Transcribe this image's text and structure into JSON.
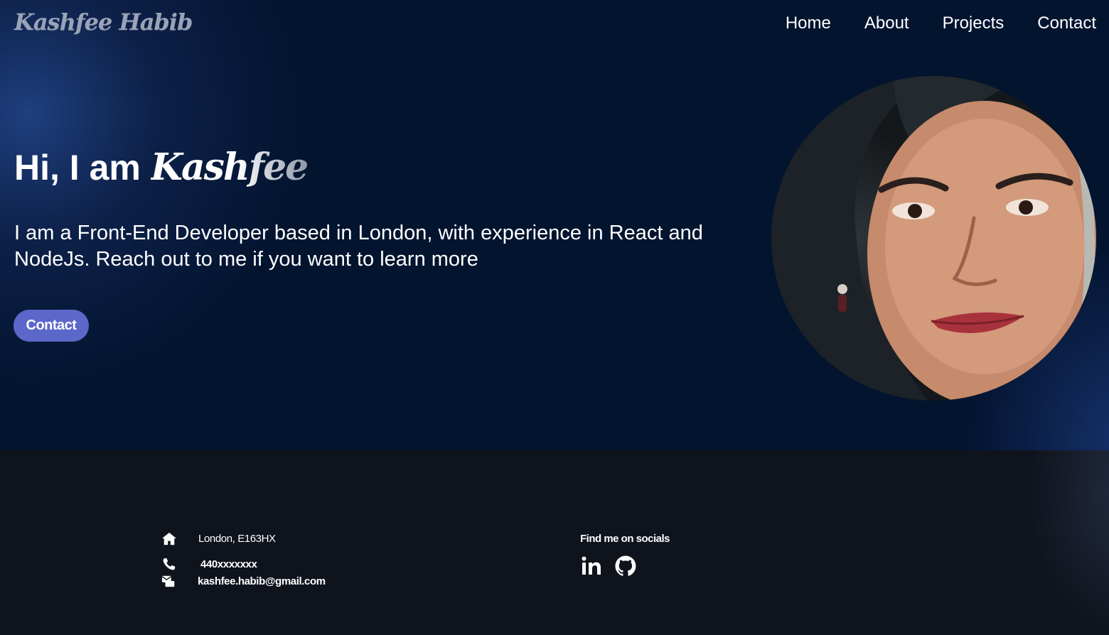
{
  "nav": {
    "logo": "Kashfee Habib",
    "links": [
      "Home",
      "About",
      "Projects",
      "Contact"
    ]
  },
  "hero": {
    "greeting": "Hi, I am",
    "name": "Kashfee",
    "intro": "I am a Front-End Developer based in London, with experience in React and NodeJs. Reach out to me if you want to learn more",
    "button_label": "Contact",
    "portrait_alt": "Portrait photo"
  },
  "footer": {
    "address": "London, E163HX",
    "phone": "440xxxxxxx",
    "email": "kashfee.habib@gmail.com",
    "socials_title": "Find me on socials",
    "social_icons": [
      "linkedin-icon",
      "github-icon"
    ]
  },
  "colors": {
    "hero_bg": "#03142f",
    "footer_bg": "#0f131c",
    "button_bg": "#5b67c9"
  }
}
